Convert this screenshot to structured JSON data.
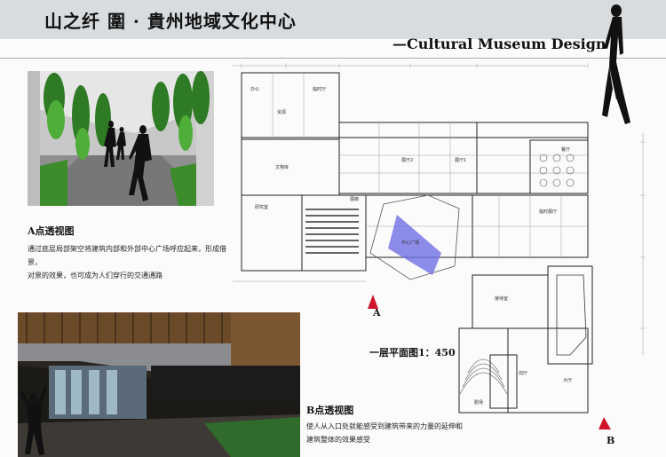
{
  "header": {
    "title": "山之纤 圍 · 貴州地域文化中心",
    "subtitle": "—Cultural Museum Design"
  },
  "view_a": {
    "heading": "A点透视图",
    "description_line1": "通过底层局部架空将建筑内部和外部中心广场呼应起来，形成借景，",
    "description_line2": "对景的效果，也可成为人们穿行的交通通路"
  },
  "view_b": {
    "heading": "B点透视图",
    "description_line1": "使人从入口处就能感受到建筑带来的力量的延伸和",
    "description_line2": "建筑整体的效果感受"
  },
  "plan": {
    "label": "一层平面图1：450",
    "marker_a": "A",
    "marker_b": "B",
    "rooms": {
      "r1": "办公",
      "r2": "临时厅",
      "r3": "资源",
      "r4": "文物库",
      "r5": "展厅2",
      "r6": "展厅1",
      "r7": "餐厅",
      "r8": "研究室",
      "r9": "展廊",
      "r10": "临时展厅",
      "r11": "中心广场",
      "r12": "接待室",
      "r13": "剧场",
      "r14": "前厅",
      "r15": "大厅"
    }
  },
  "colors": {
    "band": "#d9dcdf",
    "plaza": "#6f6fe6",
    "marker": "#d0142a"
  }
}
